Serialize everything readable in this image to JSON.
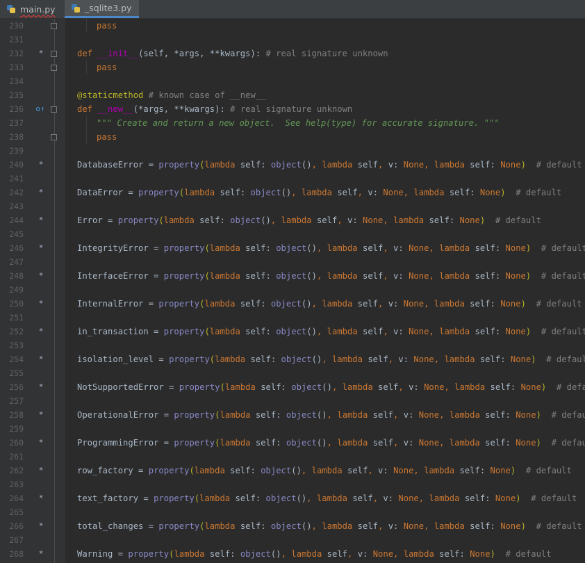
{
  "tabs": [
    {
      "label": "main.py",
      "active": false
    },
    {
      "label": "_sqlite3.py",
      "active": true
    }
  ],
  "header": {
    "lines": [
      {
        "num": "230",
        "mark": "",
        "fold": true,
        "kind": "pass"
      },
      {
        "num": "231",
        "mark": "",
        "fold": false,
        "kind": "blank"
      },
      {
        "num": "232",
        "mark": "*",
        "fold": true,
        "kind": "def_init"
      },
      {
        "num": "233",
        "mark": "",
        "fold": true,
        "kind": "pass"
      },
      {
        "num": "234",
        "mark": "",
        "fold": false,
        "kind": "blank"
      },
      {
        "num": "235",
        "mark": "",
        "fold": false,
        "kind": "decorator"
      },
      {
        "num": "236",
        "mark": "o↑",
        "fold": true,
        "kind": "def_new"
      },
      {
        "num": "237",
        "mark": "",
        "fold": false,
        "kind": "docstring"
      },
      {
        "num": "238",
        "mark": "",
        "fold": true,
        "kind": "pass"
      },
      {
        "num": "239",
        "mark": "",
        "fold": false,
        "kind": "blank"
      }
    ],
    "pass_kw": "pass",
    "def_kw": "def",
    "init_name": "__init__",
    "init_params": "(self, *args, **kwargs): ",
    "init_comment": "# real signature unknown",
    "decorator": "@staticmethod",
    "decorator_comment": " # known case of __new__",
    "new_name": "__new__",
    "new_params": "(*args, **kwargs): ",
    "new_comment": "# real signature unknown",
    "docstring": "\"\"\" Create and return a new object.  See help(type) for accurate signature. \"\"\""
  },
  "properties": [
    {
      "num": "240",
      "name": "DatabaseError",
      "blank_num": "241"
    },
    {
      "num": "242",
      "name": "DataError",
      "blank_num": "243"
    },
    {
      "num": "244",
      "name": "Error",
      "blank_num": "245"
    },
    {
      "num": "246",
      "name": "IntegrityError",
      "blank_num": "247"
    },
    {
      "num": "248",
      "name": "InterfaceError",
      "blank_num": "249"
    },
    {
      "num": "250",
      "name": "InternalError",
      "blank_num": "251"
    },
    {
      "num": "252",
      "name": "in_transaction",
      "blank_num": "253"
    },
    {
      "num": "254",
      "name": "isolation_level",
      "blank_num": "255"
    },
    {
      "num": "256",
      "name": "NotSupportedError",
      "blank_num": "257"
    },
    {
      "num": "258",
      "name": "OperationalError",
      "blank_num": "259"
    },
    {
      "num": "260",
      "name": "ProgrammingError",
      "blank_num": "261"
    },
    {
      "num": "262",
      "name": "row_factory",
      "blank_num": "263"
    },
    {
      "num": "264",
      "name": "text_factory",
      "blank_num": "265"
    },
    {
      "num": "266",
      "name": "total_changes",
      "blank_num": "267"
    },
    {
      "num": "268",
      "name": "Warning",
      "blank_num": ""
    }
  ],
  "property_tokens": {
    "mark": "*",
    "assign": " = ",
    "property": "property",
    "open": "(",
    "lambda": "lambda",
    "self": "self",
    "colon": ": ",
    "object": "object",
    "call": "()",
    "comma": ", ",
    "v": "v",
    "none": "None",
    "close": ")",
    "comment": "  # default"
  },
  "colors": {
    "background": "#2b2b2b",
    "gutter": "#313335",
    "keyword": "#cc7832",
    "function": "#ffc66d",
    "magic": "#b200b2",
    "self": "#94558d",
    "builtin": "#8888c6",
    "comment": "#808080",
    "docstring": "#629755",
    "decorator": "#bbb529",
    "tab_accent": "#4a88c7"
  },
  "icons": {
    "python_file": "python-file-icon",
    "override": "override-marker-icon",
    "asterisk": "asterisk-marker-icon",
    "fold": "fold-toggle-icon"
  }
}
